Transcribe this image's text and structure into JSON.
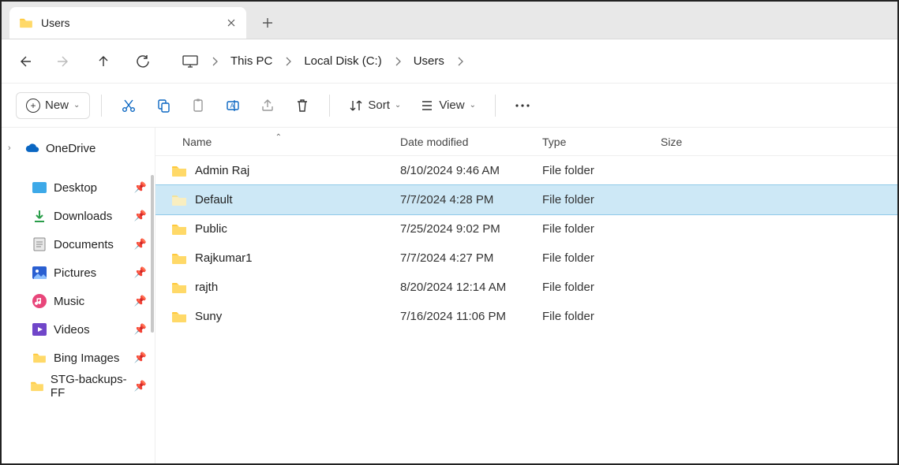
{
  "tab": {
    "title": "Users"
  },
  "breadcrumb": {
    "items": [
      "This PC",
      "Local Disk (C:)",
      "Users"
    ]
  },
  "toolbar": {
    "new_label": "New",
    "sort_label": "Sort",
    "view_label": "View"
  },
  "nav_tree": {
    "onedrive": "OneDrive",
    "items": [
      {
        "label": "Desktop",
        "icon": "desktop"
      },
      {
        "label": "Downloads",
        "icon": "downloads"
      },
      {
        "label": "Documents",
        "icon": "documents"
      },
      {
        "label": "Pictures",
        "icon": "pictures"
      },
      {
        "label": "Music",
        "icon": "music"
      },
      {
        "label": "Videos",
        "icon": "videos"
      },
      {
        "label": "Bing Images",
        "icon": "folder"
      },
      {
        "label": "STG-backups-FF",
        "icon": "folder"
      }
    ]
  },
  "columns": {
    "name": "Name",
    "date": "Date modified",
    "type": "Type",
    "size": "Size"
  },
  "files": [
    {
      "name": "Admin Raj",
      "date": "8/10/2024 9:46 AM",
      "type": "File folder",
      "size": "",
      "selected": false
    },
    {
      "name": "Default",
      "date": "7/7/2024 4:28 PM",
      "type": "File folder",
      "size": "",
      "selected": true,
      "hidden_look": true
    },
    {
      "name": "Public",
      "date": "7/25/2024 9:02 PM",
      "type": "File folder",
      "size": "",
      "selected": false
    },
    {
      "name": "Rajkumar1",
      "date": "7/7/2024 4:27 PM",
      "type": "File folder",
      "size": "",
      "selected": false
    },
    {
      "name": "rajth",
      "date": "8/20/2024 12:14 AM",
      "type": "File folder",
      "size": "",
      "selected": false
    },
    {
      "name": "Suny",
      "date": "7/16/2024 11:06 PM",
      "type": "File folder",
      "size": "",
      "selected": false
    }
  ]
}
